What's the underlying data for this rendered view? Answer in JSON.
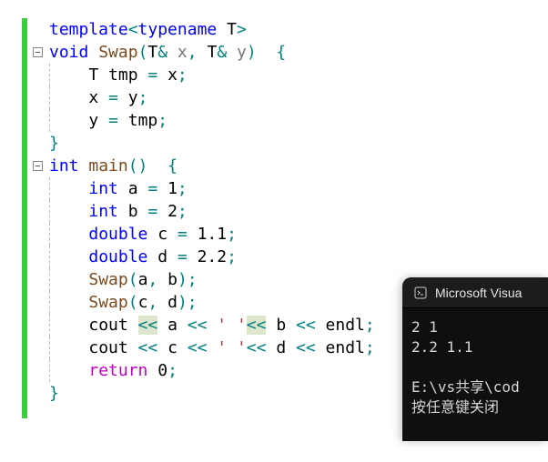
{
  "code": {
    "l1": {
      "template": "template",
      "lt": "<",
      "typename": "typename",
      "T": " T",
      "gt": ">"
    },
    "l2": {
      "void": "void",
      "fn": "Swap",
      "lp": "(",
      "t1": "T",
      "amp1": "&",
      "x": " x",
      "comma": ",",
      "t2": " T",
      "amp2": "&",
      "y": " y",
      "rp": ")",
      "space": "  ",
      "lb": "{"
    },
    "l3": {
      "T": "T",
      "rest": " tmp ",
      "eq": "=",
      "x": " x",
      "semi": ";"
    },
    "l4": {
      "x": "x ",
      "eq": "=",
      "y": " y",
      "semi": ";"
    },
    "l5": {
      "y": "y ",
      "eq": "=",
      "tmp": " tmp",
      "semi": ";"
    },
    "l6": {
      "rb": "}"
    },
    "l7": {
      "int": "int",
      "fn": " main",
      "lp": "(",
      ")": ")",
      "space": "  ",
      "lb": "{"
    },
    "l8": {
      "int": "int",
      "a": " a ",
      "eq": "=",
      "val": " 1",
      "semi": ";"
    },
    "l9": {
      "int": "int",
      "b": " b ",
      "eq": "=",
      "val": " 2",
      "semi": ";"
    },
    "l10": {
      "double": "double",
      "c": " c ",
      "eq": "=",
      "val": " 1.1",
      "semi": ";"
    },
    "l11": {
      "double": "double",
      "d": " d ",
      "eq": "=",
      "val": " 2.2",
      "semi": ";"
    },
    "l12": {
      "fn": "Swap",
      "lp": "(",
      "a": "a",
      "comma": ",",
      "b": " b",
      "rp": ")",
      "semi": ";"
    },
    "l13": {
      "fn": "Swap",
      "lp": "(",
      "c": "c",
      "comma": ",",
      "d": " d",
      "rp": ")",
      "semi": ";"
    },
    "l14": {
      "cout": "cout ",
      "lt1": "<<",
      "a": " a ",
      "lt2": "<<",
      "ch": " ' '",
      "lt3": "<<",
      "b": " b ",
      "lt4": "<<",
      "endl": " endl",
      "semi": ";"
    },
    "l15": {
      "cout": "cout ",
      "lt1": "<<",
      "c": " c ",
      "lt2": "<<",
      "ch": " ' '",
      "lt3": "<<",
      "d": " d ",
      "lt4": "<<",
      "endl": " endl",
      "semi": ";"
    },
    "l16": {
      "return": "return",
      "val": " 0",
      "semi": ";"
    },
    "l17": {
      "rb": "}"
    }
  },
  "console": {
    "title": "Microsoft Visua",
    "out1": "2 1",
    "out2": "2.2 1.1",
    "blank": "",
    "path": "E:\\vs共享\\cod",
    "msg": "按任意键关闭"
  }
}
